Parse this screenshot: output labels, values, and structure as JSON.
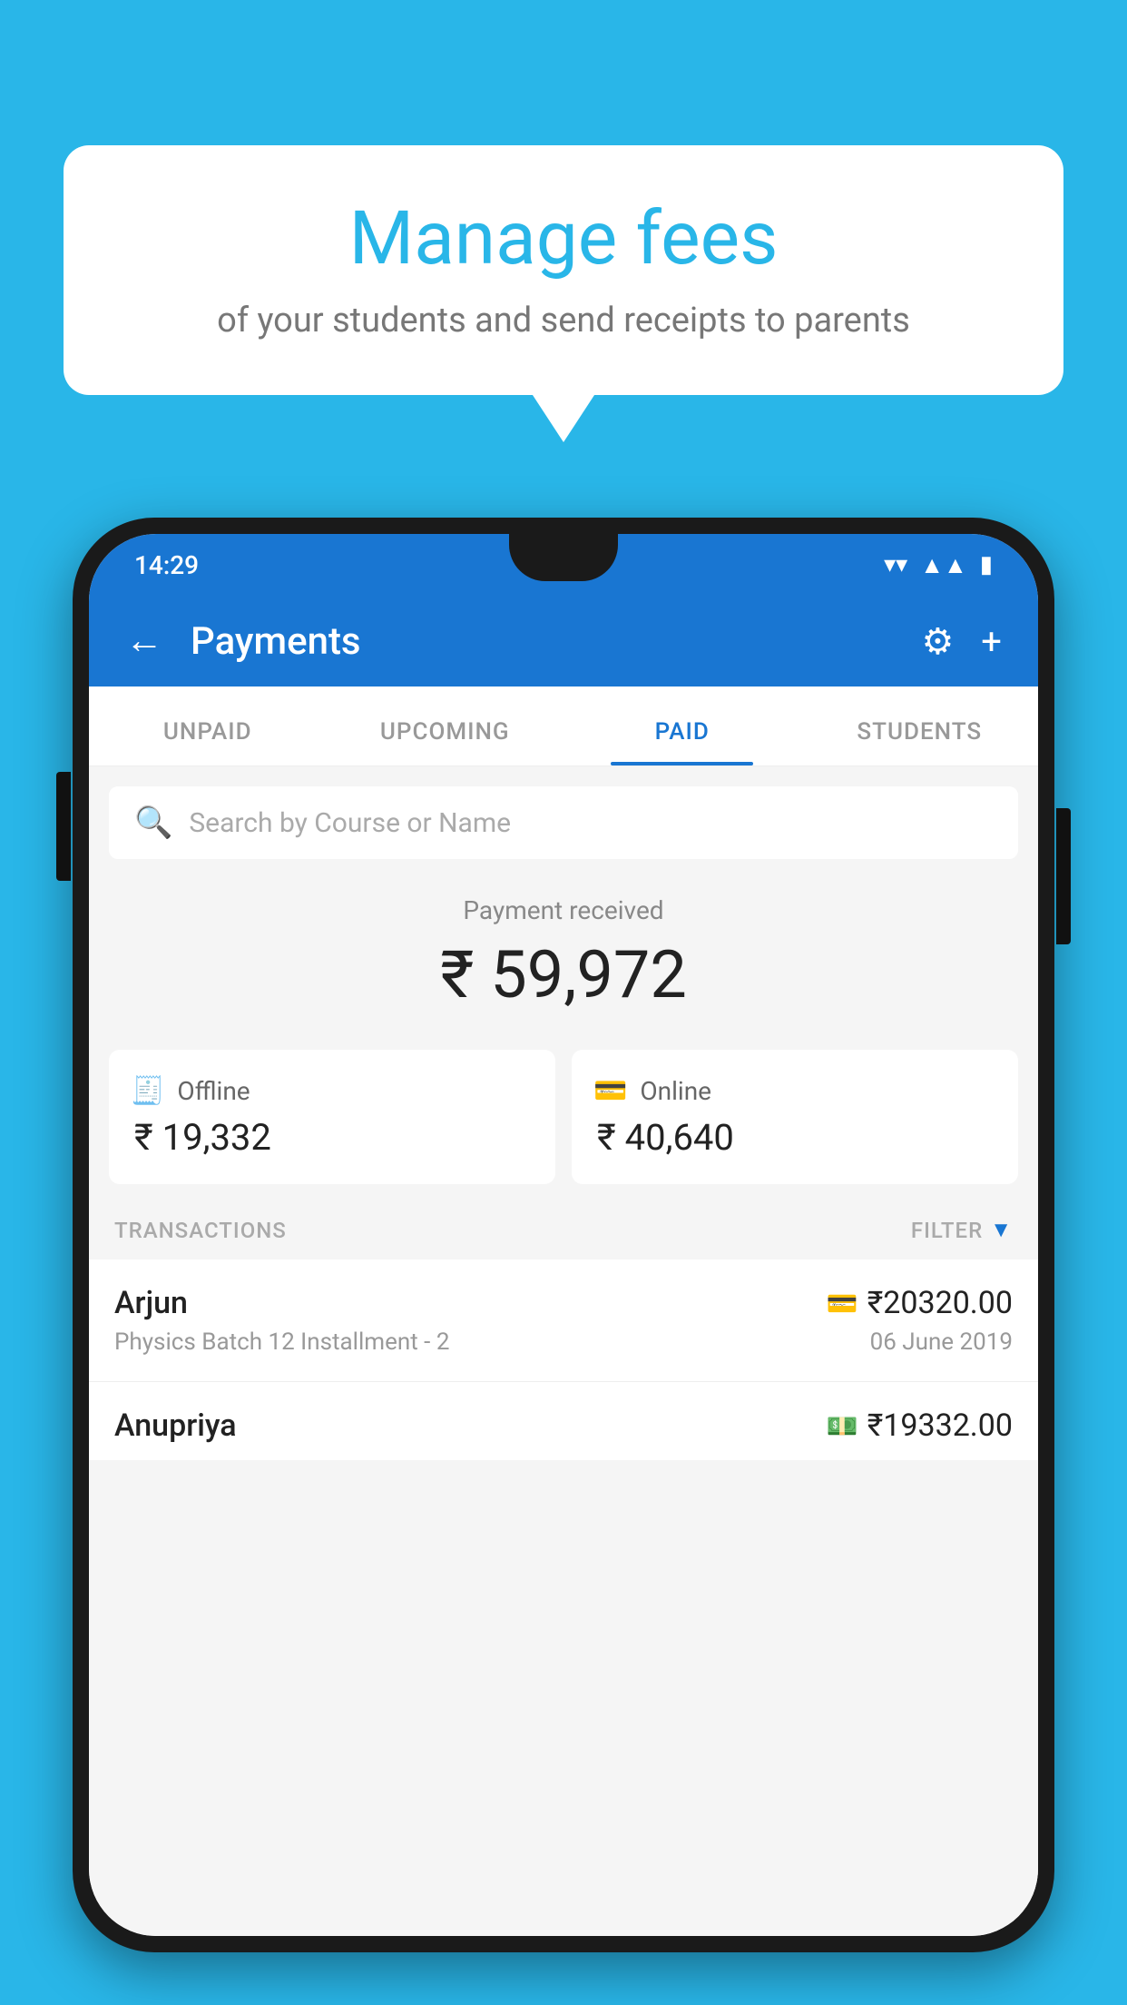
{
  "background_color": "#29b6e8",
  "bubble": {
    "title": "Manage fees",
    "subtitle": "of your students and send receipts to parents"
  },
  "status_bar": {
    "time": "14:29",
    "wifi_icon": "wifi",
    "signal_icon": "signal",
    "battery_icon": "battery"
  },
  "top_bar": {
    "title": "Payments",
    "back_label": "←",
    "gear_label": "⚙",
    "plus_label": "+"
  },
  "tabs": [
    {
      "label": "UNPAID",
      "active": false
    },
    {
      "label": "UPCOMING",
      "active": false
    },
    {
      "label": "PAID",
      "active": true
    },
    {
      "label": "STUDENTS",
      "active": false
    }
  ],
  "search": {
    "placeholder": "Search by Course or Name"
  },
  "payment_received": {
    "label": "Payment received",
    "amount": "₹ 59,972"
  },
  "cards": [
    {
      "icon": "💳",
      "label": "Offline",
      "amount": "₹ 19,332"
    },
    {
      "icon": "💳",
      "label": "Online",
      "amount": "₹ 40,640"
    }
  ],
  "transactions_header": {
    "label": "TRANSACTIONS",
    "filter_label": "FILTER"
  },
  "transactions": [
    {
      "name": "Arjun",
      "type_icon": "💳",
      "amount": "₹20320.00",
      "description": "Physics Batch 12 Installment - 2",
      "date": "06 June 2019"
    },
    {
      "name": "Anupriya",
      "type_icon": "💵",
      "amount": "₹19332.00",
      "description": "",
      "date": ""
    }
  ]
}
